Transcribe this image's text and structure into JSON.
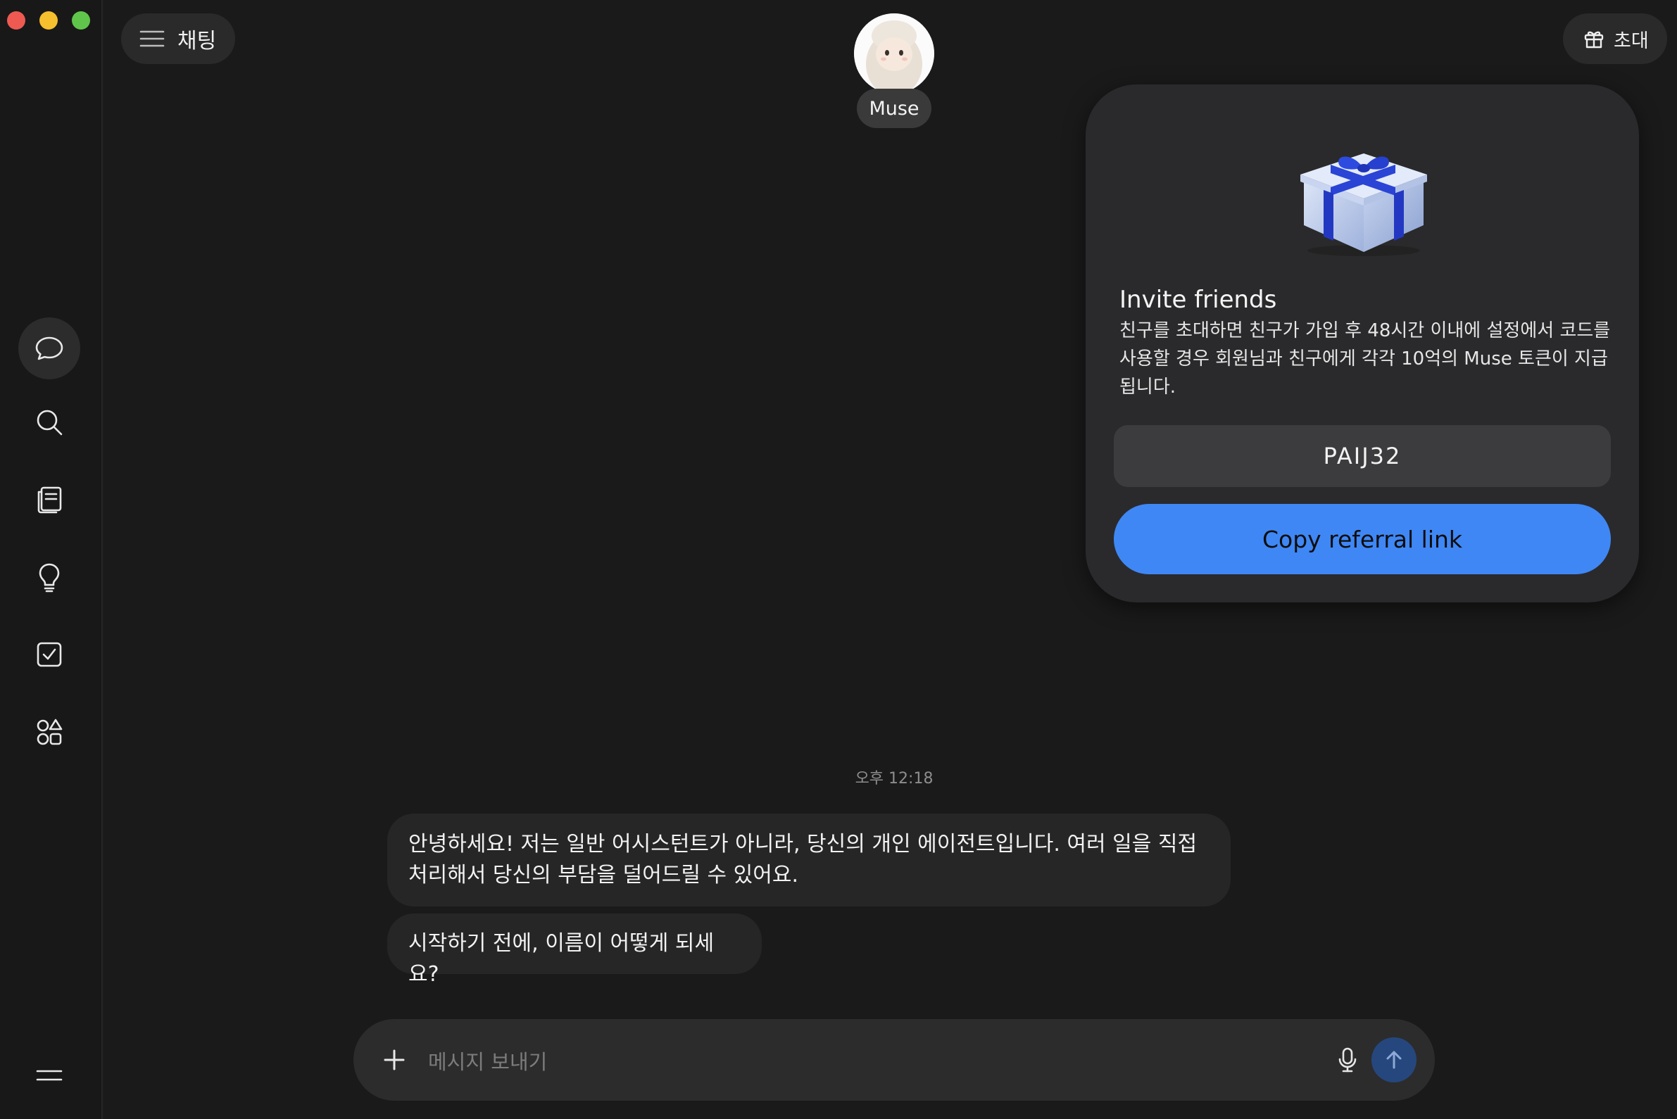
{
  "header": {
    "chat_label": "채팅",
    "invite_label": "초대"
  },
  "agent": {
    "name": "Muse"
  },
  "invite_card": {
    "title": "Invite friends",
    "description": "친구를 초대하면 친구가 가입 후 48시간 이내에 설정에서 코드를 사용할 경우 회원님과 친구에게 각각 10억의 Muse 토큰이 지급됩니다.",
    "code": "PAIJ32",
    "copy_button": "Copy referral link"
  },
  "conversation": {
    "timestamp": "오후 12:18",
    "messages": [
      "안녕하세요! 저는 일반 어시스턴트가 아니라, 당신의 개인 에이전트입니다. 여러 일을 직접 처리해서 당신의 부담을 덜어드릴 수 있어요.",
      "시작하기 전에, 이름이 어떻게 되세요?"
    ]
  },
  "composer": {
    "placeholder": "메시지 보내기"
  },
  "sidebar": {
    "icons": [
      "chat-icon",
      "search-icon",
      "library-icon",
      "lightbulb-icon",
      "checkbox-icon",
      "apps-icon",
      "menu-icon"
    ]
  },
  "colors": {
    "background": "#1a1a1a",
    "accent_blue": "#3f87f5",
    "card": "#2a2a2c"
  }
}
